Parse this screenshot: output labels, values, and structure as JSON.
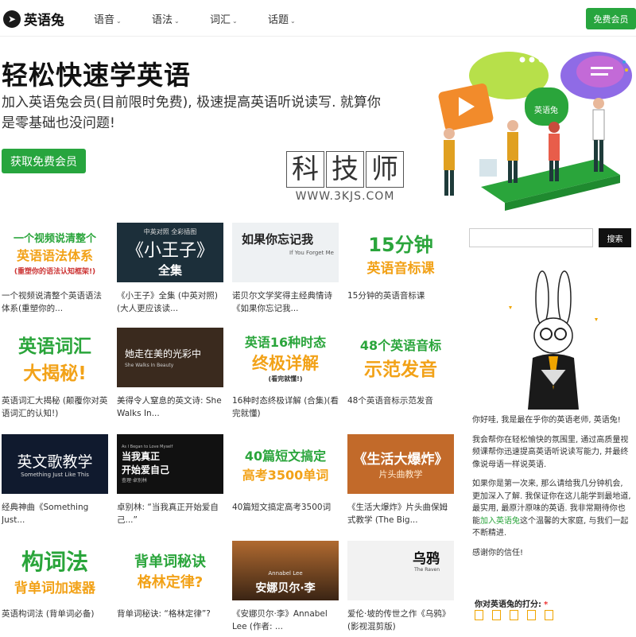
{
  "header": {
    "logo_text": "英语兔",
    "nav": [
      "语音",
      "语法",
      "词汇",
      "话题"
    ],
    "cta": "免费会员"
  },
  "hero": {
    "title": "轻松快速学英语",
    "subtitle": "加入英语兔会员(目前限时免费), 极速提高英语听说读写. 就算你是零基础也没问题!",
    "cta": "获取免费会员",
    "illus_badge": "英语兔"
  },
  "watermark": {
    "chars": [
      "科",
      "技",
      "师"
    ],
    "url": "WWW.3KJS.COM"
  },
  "cards": [
    {
      "t1": "一个视频说清整个",
      "t2": "英语语法体系",
      "t3": "(重塑你的语法认知框架!)",
      "caption": "一个视频说清整个英语语法体系(重塑你的..."
    },
    {
      "t0": "中英对照 全彩插图",
      "t1": "《小王子》",
      "t2": "全集",
      "caption": "《小王子》全集 (中英对照) (大人更应该读..."
    },
    {
      "t1": "如果你忘记我",
      "t2": "If You Forget Me",
      "caption": "诺贝尔文学奖得主经典情诗《如果你忘记我..."
    },
    {
      "t1": "15分钟",
      "t2": "英语音标课",
      "caption": "15分钟的英语音标课"
    },
    {
      "t1": "英语词汇",
      "t2": "大揭秘!",
      "caption": "英语词汇大揭秘 (颠覆你对英语词汇的认知!)"
    },
    {
      "t1": "她走在美的光彩中",
      "t2": "She Walks In Beauty",
      "caption": "美得令人窒息的英文诗: She Walks In..."
    },
    {
      "t1": "英语16种时态",
      "t2": "终极详解",
      "t3": "(看完就懂!)",
      "caption": "16种时态终极详解 (合集)(看完就懂)"
    },
    {
      "t1": "48个英语音标",
      "t2": "示范发音",
      "caption": "48个英语音标示范发音"
    },
    {
      "t1": "英文歌教学",
      "t2": "Something Just Like This",
      "caption": "经典神曲《Something Just..."
    },
    {
      "t0": "As I Began to Love Myself",
      "t1": "当我真正",
      "t2": "开始爱自己",
      "t3": "查理·卓别林",
      "caption": "卓别林: “当我真正开始爱自己...”"
    },
    {
      "t1": "40篇短文搞定",
      "t2": "高考3500单词",
      "caption": "40篇短文搞定高考3500词"
    },
    {
      "t1": "《生活大爆炸》",
      "t2": "片头曲教学",
      "caption": "《生活大爆炸》片头曲保姆式教学 (The Big..."
    },
    {
      "t1": "构词法",
      "t2": "背单词加速器",
      "caption": "英语构词法 (背单词必备)"
    },
    {
      "t1": "背单词秘诀",
      "t2": "格林定律?",
      "caption": "背单词秘诀: “格林定律”?"
    },
    {
      "t0": "Annabel Lee",
      "t1": "安娜贝尔·李",
      "caption": "《安娜贝尔·李》Annabel Lee (作者: ..."
    },
    {
      "t1": "乌鸦",
      "t2": "The Raven",
      "caption": "爱伦·坡的传世之作《乌鸦》(影视混剪版)"
    }
  ],
  "sidebar": {
    "search_button": "搜索",
    "intro": [
      {
        "text": "你好哇, 我是最在乎你的英语老师, 英语兔!"
      },
      {
        "text": "我会帮你在轻松愉快的氛围里, 通过高质量视频课帮你迅速提高英语听说读写能力, 并最终像说母语一样说英语."
      },
      {
        "before": "如果你是第一次来, 那么请给我几分钟机会, 更加深入了解. 我保证你在这儿能学到最地道, 最实用, 最原汁原味的英语. 我非常期待你也能",
        "link": "加入英语兔",
        "after": "这个温馨的大家庭, 与我们一起不断精进."
      },
      {
        "text": "感谢你的信任!"
      }
    ],
    "rating_label": "你对英语兔的打分:",
    "rating_required": "*"
  }
}
